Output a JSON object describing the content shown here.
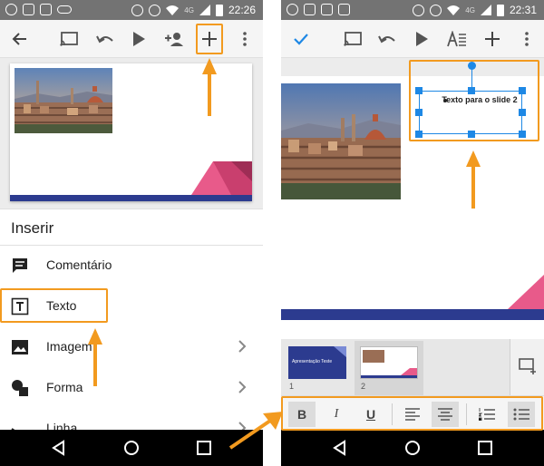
{
  "left_screen": {
    "status_bar": {
      "time": "22:26",
      "network": "4G"
    },
    "toolbar": {
      "buttons": [
        "back",
        "cast",
        "undo",
        "play",
        "share",
        "add"
      ]
    },
    "insert_menu": {
      "title": "Inserir",
      "items": [
        {
          "label": "Comentário",
          "icon": "comment-icon",
          "has_submenu": false
        },
        {
          "label": "Texto",
          "icon": "text-box-icon",
          "has_submenu": false,
          "highlighted": true
        },
        {
          "label": "Imagem",
          "icon": "image-icon",
          "has_submenu": true
        },
        {
          "label": "Forma",
          "icon": "shape-icon",
          "has_submenu": true
        },
        {
          "label": "Linha",
          "icon": "line-icon",
          "has_submenu": true
        }
      ]
    }
  },
  "right_screen": {
    "status_bar": {
      "time": "22:31",
      "network": "4G"
    },
    "toolbar": {
      "buttons": [
        "done",
        "cast",
        "undo",
        "play",
        "text-format",
        "add",
        "more"
      ]
    },
    "text_box": {
      "text": "Texto para o slide 2"
    },
    "filmstrip": {
      "slides": [
        {
          "number": "1",
          "title": "Apresentação Teste"
        },
        {
          "number": "2",
          "title": ""
        }
      ]
    },
    "format_bar": {
      "buttons": [
        {
          "label": "B",
          "name": "bold",
          "active": true
        },
        {
          "label": "I",
          "name": "italic",
          "active": false
        },
        {
          "label": "U",
          "name": "underline",
          "active": false
        },
        {
          "label": "",
          "name": "align-left",
          "active": false
        },
        {
          "label": "",
          "name": "align-center",
          "active": true
        },
        {
          "label": "",
          "name": "numbered-list",
          "active": false
        },
        {
          "label": "",
          "name": "bulleted-list",
          "active": true
        }
      ]
    }
  },
  "colors": {
    "highlight": "#f29a1f",
    "selection": "#1e88e5",
    "toolbar_icon_accent": "#1e88e5",
    "slide_stripe": "#2c3b8f",
    "slide_pink": "#e85a8a"
  }
}
